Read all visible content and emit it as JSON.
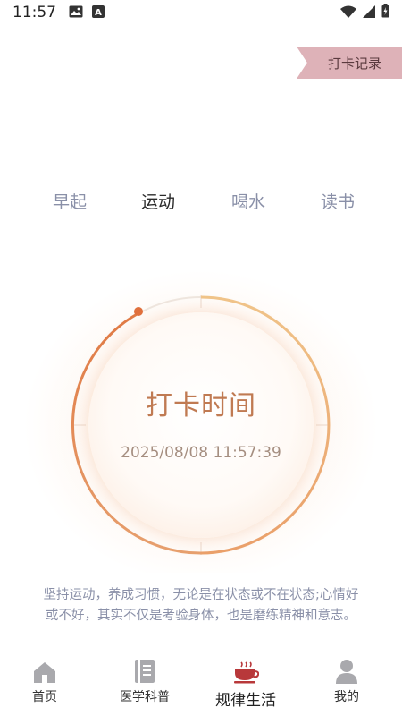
{
  "status_bar": {
    "time": "11:57"
  },
  "record_button": {
    "label": "打卡记录"
  },
  "tabs": [
    {
      "label": "早起",
      "active": false
    },
    {
      "label": "运动",
      "active": true
    },
    {
      "label": "喝水",
      "active": false
    },
    {
      "label": "读书",
      "active": false
    }
  ],
  "checkin": {
    "title": "打卡时间",
    "datetime": "2025/08/08 11:57:39"
  },
  "description": "坚持运动，养成习惯，无论是在状态或不在状态;心情好或不好，其实不仅是考验身体，也是磨练精神和意志。",
  "nav": [
    {
      "label": "首页",
      "icon": "home-icon",
      "active": false
    },
    {
      "label": "医学科普",
      "icon": "book-icon",
      "active": false
    },
    {
      "label": "规律生活",
      "icon": "teacup-icon",
      "active": true
    },
    {
      "label": "我的",
      "icon": "user-icon",
      "active": false
    }
  ],
  "colors": {
    "accent_ring": "#e0874d",
    "active_nav_icon": "#b8383a",
    "record_tag": "#deb2b8",
    "tab_inactive": "#8a90a8"
  }
}
